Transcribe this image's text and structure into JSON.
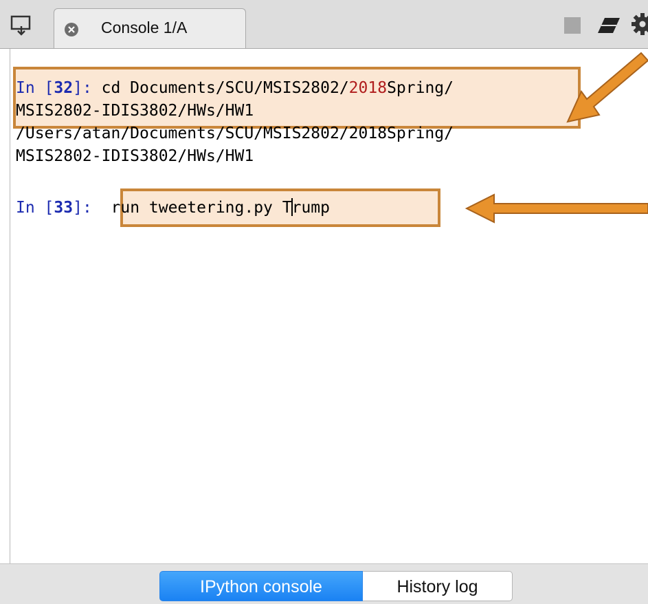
{
  "tab": {
    "label": "Console 1/A"
  },
  "icons": {
    "pane_menu": "pane-menu-icon",
    "close": "close-icon",
    "stop": "stop-icon",
    "eraser": "eraser-icon",
    "gear": "gear-icon"
  },
  "console": {
    "in32": {
      "prompt_open": "In [",
      "number": "32",
      "prompt_close": "]: ",
      "cmd_a": "cd Documents/SCU/MSIS2802/",
      "cmd_year": "2018",
      "cmd_b": "Spring/",
      "cmd_line2": "MSIS2802-IDIS3802/HWs/HW1"
    },
    "output": {
      "line1": "/Users/atan/Documents/SCU/MSIS2802/2018Spring/",
      "line2": "MSIS2802-IDIS3802/HWs/HW1"
    },
    "in33": {
      "prompt_open": "In [",
      "number": "33",
      "prompt_close": "]:",
      "input_before_cursor": "run tweetering.py T",
      "input_after_cursor": "rump"
    }
  },
  "annotations": {
    "color": "#e8922c",
    "fill": "#fbe7d4"
  },
  "bottom_tabs": {
    "ipython": "IPython console",
    "history": "History log"
  },
  "colors": {
    "prompt": "#1c2bb0",
    "number_literal": "#b01d1d",
    "active_tab": "#1b82f3"
  }
}
